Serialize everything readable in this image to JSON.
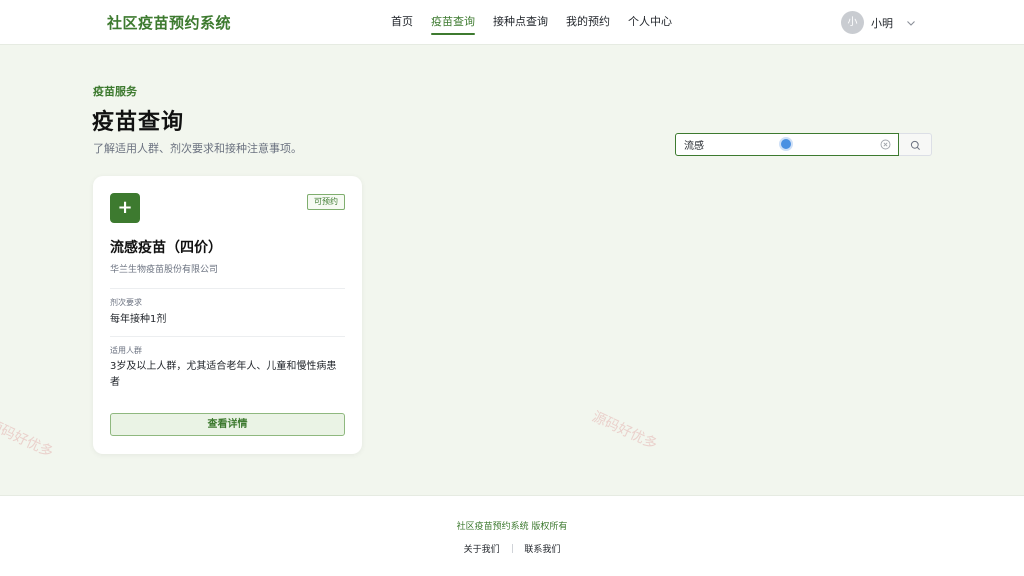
{
  "header": {
    "app_title": "社区疫苗预约系统",
    "nav": [
      {
        "label": "首页",
        "active": false
      },
      {
        "label": "疫苗查询",
        "active": true
      },
      {
        "label": "接种点查询",
        "active": false
      },
      {
        "label": "我的预约",
        "active": false
      },
      {
        "label": "个人中心",
        "active": false
      }
    ],
    "user": {
      "avatar_text": "小",
      "name": "小明"
    }
  },
  "hero": {
    "eyebrow": "疫苗服务",
    "title": "疫苗查询",
    "subtitle": "了解适用人群、剂次要求和接种注意事项。"
  },
  "search": {
    "value": "流感",
    "clear_icon": "clear-circle-icon",
    "button_icon": "search-icon"
  },
  "vaccines": [
    {
      "icon": "plus-icon",
      "status": "可预约",
      "name": "流感疫苗（四价）",
      "manufacturer": "华兰生物疫苗股份有限公司",
      "dose_label": "剂次要求",
      "dose_value": "每年接种1剂",
      "audience_label": "适用人群",
      "audience_value": "3岁及以上人群，尤其适合老年人、儿童和慢性病患者",
      "detail_button": "查看详情"
    }
  ],
  "footer": {
    "copyright": "社区疫苗预约系统 版权所有",
    "links": [
      "关于我们",
      "联系我们"
    ]
  },
  "watermark": "源码好优多",
  "colors": {
    "brand": "#3d7a2f",
    "background": "#f2f6ee",
    "accent_blue": "#4a90e2"
  }
}
